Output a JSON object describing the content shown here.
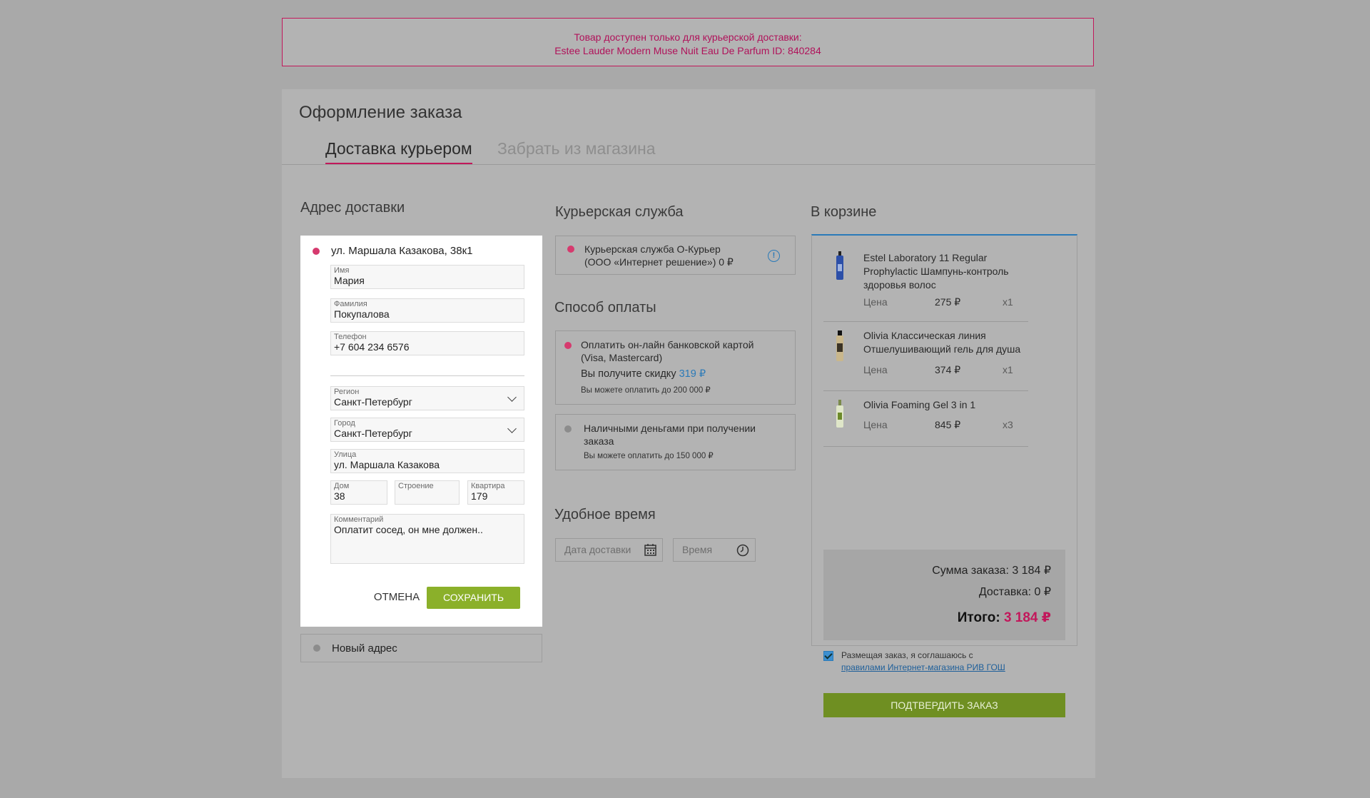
{
  "alert": {
    "line1": "Товар доступен только для курьерской доставки:",
    "line2": "Estee Lauder Modern Muse Nuit Eau De Parfum ID: 840284"
  },
  "page_title": "Оформление заказа",
  "tabs": [
    {
      "label": "Доставка курьером",
      "active": true
    },
    {
      "label": "Забрать из магазина",
      "active": false
    }
  ],
  "address": {
    "section_title": "Адрес доставки",
    "selected": "ул. Маршала Казакова, 38к1",
    "fields": {
      "first_name": {
        "label": "Имя",
        "value": "Мария"
      },
      "last_name": {
        "label": "Фамилия",
        "value": "Покупалова"
      },
      "phone": {
        "label": "Телефон",
        "value": "+7 604 234 6576"
      },
      "region": {
        "label": "Регион",
        "value": "Санкт-Петербург"
      },
      "city": {
        "label": "Город",
        "value": "Санкт-Петербург"
      },
      "street": {
        "label": "Улица",
        "value": "ул. Маршала Казакова"
      },
      "house": {
        "label": "Дом",
        "value": "38"
      },
      "building": {
        "label": "Строение",
        "value": ""
      },
      "apartment": {
        "label": "Квартира",
        "value": "179"
      },
      "comment": {
        "label": "Комментарий",
        "value": "Оплатит сосед, он мне должен.."
      }
    },
    "cancel_label": "ОТМЕНА",
    "save_label": "СОХРАНИТЬ",
    "new_address_label": "Новый адрес"
  },
  "courier": {
    "section_title": "Курьерская служба",
    "line1": "Курьерская служба О-Курьер",
    "line2": "(ООО «Интернет решение») 0 ₽"
  },
  "payment": {
    "section_title": "Способ оплаты",
    "online": {
      "line1": "Оплатить он-лайн банковской картой",
      "line2": "(Visa, Mastercard)",
      "discount_prefix": "Вы получите скидку",
      "discount_value": "319 ₽",
      "limit": "Вы можете оплатить до 200 000 ₽"
    },
    "cash": {
      "line1": "Наличными деньгами при получении",
      "line2": "заказа",
      "limit": "Вы можете оплатить до 150 000 ₽"
    }
  },
  "time": {
    "section_title": "Удобное время",
    "date_placeholder": "Дата доставки",
    "time_placeholder": "Время"
  },
  "cart": {
    "section_title": "В корзине",
    "price_label": "Цена",
    "items": [
      {
        "name": "Estel Laboratory 11 Regular Prophylactic Шампунь-контроль здоровья волос",
        "price": "275 ₽",
        "qty": "x1"
      },
      {
        "name": "Olivia Классическая линия Отшелушивающий гель для душа",
        "price": "374 ₽",
        "qty": "x1"
      },
      {
        "name": "Olivia Foaming Gel 3 in 1",
        "price": "845 ₽",
        "qty": "x3"
      }
    ],
    "sum_label": "Сумма заказа: 3 184 ₽",
    "delivery_label": "Доставка: 0 ₽",
    "total_label": "Итого:",
    "total_value": "3 184 ₽",
    "agree_text": "Размещая заказ, я соглашаюсь с",
    "agree_link": "правилами Интернет-магазина РИВ ГОШ",
    "confirm_label": "ПОДТВЕРДИТЬ ЗАКАЗ"
  },
  "colors": {
    "accent_pink": "#c2185b",
    "accent_green": "#8bb02a",
    "confirm_green": "#6f8f22",
    "link_blue": "#2a7ab8"
  }
}
